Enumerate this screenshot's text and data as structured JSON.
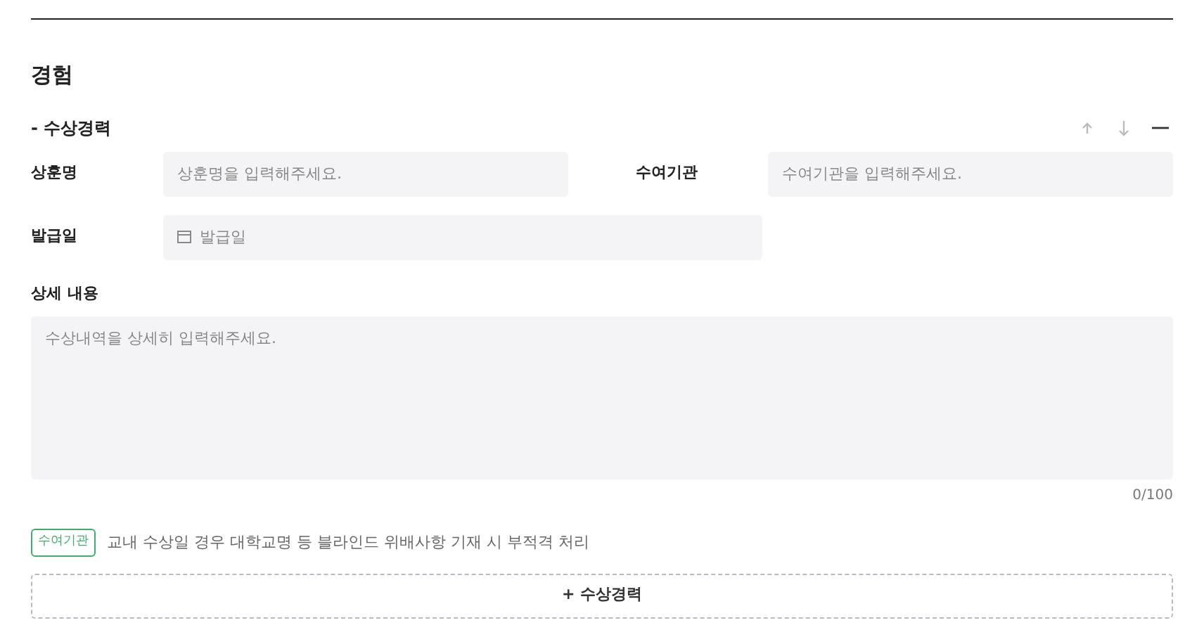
{
  "section_title": "경험",
  "subsection": {
    "title": "- 수상경력",
    "actions": [
      {
        "kind": "up"
      },
      {
        "kind": "down"
      },
      {
        "kind": "remove"
      }
    ]
  },
  "fields": [
    {
      "label": "상훈명",
      "placeholder": "상훈명을 입력해주세요."
    },
    {
      "label": "수여기관",
      "placeholder": "수여기관을 입력해주세요."
    },
    {
      "label": "발급일",
      "placeholder": "발급일",
      "kind": "date"
    }
  ],
  "detail": {
    "label": "상세 내용",
    "placeholder": "수상내역을 상세히 입력해주세요.",
    "counter": "0/100"
  },
  "notice": {
    "tag": "수여기관",
    "text": "교내 수상일 경우 대학교명 등 블라인드 위배사항 기재 시 부적격 처리"
  },
  "add_button": {
    "icon": "+",
    "label": "수상경력"
  }
}
